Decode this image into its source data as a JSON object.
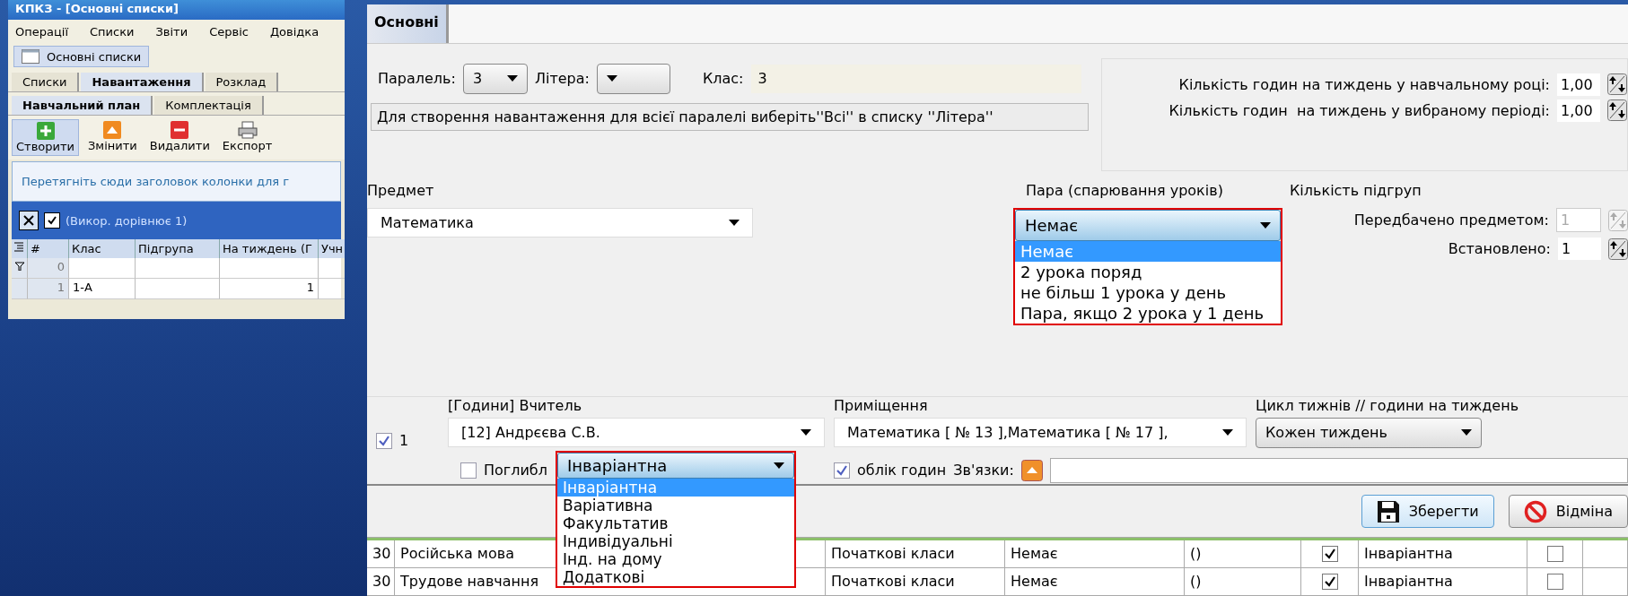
{
  "small_window": {
    "title": "КПКЗ - [Основні списки]",
    "menu": [
      "Операції",
      "Списки",
      "Звіти",
      "Сервіс",
      "Довідка"
    ],
    "mdi_tab": "Основні списки",
    "tabs": [
      {
        "label": "Списки",
        "selected": false
      },
      {
        "label": "Навантаження",
        "selected": true
      },
      {
        "label": "Розклад",
        "selected": false
      }
    ],
    "subtabs": [
      {
        "label": "Навчальний план",
        "selected": true
      },
      {
        "label": "Комплектація",
        "selected": false
      }
    ],
    "toolbar": [
      {
        "label": "Створити",
        "kind": "create",
        "selected": true
      },
      {
        "label": "Змінити",
        "kind": "edit",
        "selected": false
      },
      {
        "label": "Видалити",
        "kind": "delete",
        "selected": false
      },
      {
        "label": "Експорт",
        "kind": "print",
        "selected": false
      }
    ],
    "group_hint": "Перетягніть сюди заголовок колонки для г",
    "filter": {
      "text": "(Викор. дорівнює 1)",
      "checked": true
    },
    "grid": {
      "columns": [
        "#",
        "Клас",
        "Підгрупа",
        "На тиждень (Г",
        "Учн"
      ],
      "filter_row": {
        "number": "0"
      },
      "rows": [
        {
          "number": "1",
          "class": "1-А",
          "per_week": "1"
        }
      ]
    }
  },
  "main": {
    "tabs": [
      {
        "label": "Основні",
        "selected": true
      }
    ],
    "parallel": {
      "label": "Паралель:",
      "value": "3"
    },
    "letter": {
      "label": "Літера:"
    },
    "class": {
      "label": "Клас:",
      "value": "3"
    },
    "hint": "Для створення навантаження для всієї паралелі виберіть''Всі'' в списку ''Літера''",
    "hours": [
      {
        "label": "Кількість годин на тиждень у навчальному році:",
        "value": "1,00"
      },
      {
        "label": "Кількість годин  на тиждень у вибраному періоді:",
        "value": "1,00"
      }
    ],
    "subject": {
      "label": "Предмет",
      "value": "Математика"
    },
    "pair": {
      "label": "Пара (спарювання уроків)",
      "value": "Немає",
      "expanded": true,
      "options": [
        {
          "label": "Немає",
          "selected": true
        },
        {
          "label": "2 урока поряд",
          "selected": false
        },
        {
          "label": "не більш 1 урока у день",
          "selected": false
        },
        {
          "label": "Пара, якщо 2 урока у 1 день",
          "selected": false
        }
      ]
    },
    "subgroups": {
      "label": "Кількість підгруп",
      "rows": [
        {
          "label": "Передбачено предметом:",
          "value": "1",
          "disabled": true
        },
        {
          "label": "Встановлено:",
          "value": "1",
          "disabled": false
        }
      ]
    },
    "teacher_row": {
      "checked": true,
      "number": "1",
      "teacher": {
        "label": "[Години] Вчитель",
        "value": "[12] Андрєєва С.В."
      },
      "in_depth": {
        "label": "Поглибл",
        "checked": false
      },
      "component": {
        "value": "Інваріантна",
        "expanded": true,
        "options": [
          {
            "label": "Інваріантна",
            "selected": true
          },
          {
            "label": "Варіативна",
            "selected": false
          },
          {
            "label": "Факультатив",
            "selected": false
          },
          {
            "label": "Індивідуальні",
            "selected": false
          },
          {
            "label": "Інд. на дому",
            "selected": false
          },
          {
            "label": "Додаткові",
            "selected": false
          }
        ]
      },
      "room": {
        "label": "Приміщення",
        "value": "Математика [ № 13 ],Математика [ № 17 ],"
      },
      "hours_accounting": {
        "label": "облік годин",
        "checked": true
      },
      "links_label": "Зв'язки:",
      "cycle": {
        "label": "Цикл тижнів // години на тиждень",
        "value": "Кожен тиждень"
      }
    },
    "buttons": [
      {
        "label": "Зберегти",
        "kind": "save"
      },
      {
        "label": "Відміна",
        "kind": "cancel"
      }
    ],
    "grid_rows": [
      {
        "number": "30",
        "subject": "Російська мова",
        "group": "Початкові класи",
        "pair": "Немає",
        "rooms": "()",
        "counted": true,
        "component": "Інваріантна",
        "flag": false
      },
      {
        "number": "30",
        "subject": "Трудове навчання",
        "group": "Початкові класи",
        "pair": "Немає",
        "rooms": "()",
        "counted": true,
        "component": "Інваріантна",
        "flag": false
      }
    ]
  }
}
